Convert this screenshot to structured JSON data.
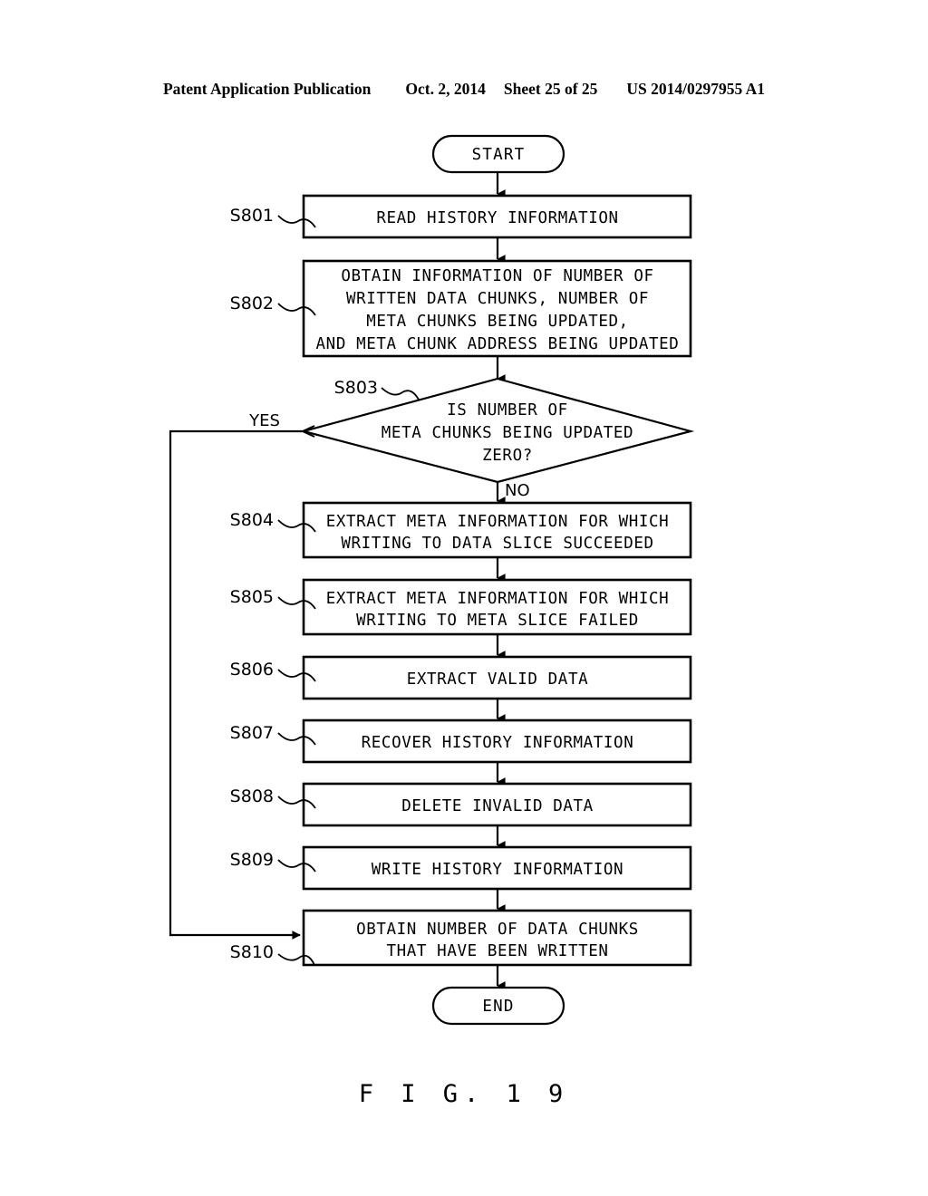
{
  "header": {
    "publication": "Patent Application Publication",
    "date": "Oct. 2, 2014",
    "sheet": "Sheet 25 of 25",
    "doc_number": "US 2014/0297955 A1"
  },
  "figure": {
    "caption": "F I G.  1 9"
  },
  "flowchart": {
    "start_label": "START",
    "end_label": "END",
    "yes_label": "YES",
    "no_label": "NO",
    "steps": [
      {
        "id": "S801",
        "lines": [
          "READ HISTORY INFORMATION"
        ]
      },
      {
        "id": "S802",
        "lines": [
          "OBTAIN INFORMATION OF NUMBER OF",
          "WRITTEN DATA CHUNKS, NUMBER OF",
          "META CHUNKS BEING UPDATED,",
          "AND META CHUNK ADDRESS BEING UPDATED"
        ]
      },
      {
        "id": "S803",
        "lines": [
          "IS NUMBER OF",
          "META CHUNKS BEING UPDATED",
          "ZERO?"
        ]
      },
      {
        "id": "S804",
        "lines": [
          "EXTRACT META INFORMATION FOR WHICH",
          "WRITING TO DATA SLICE SUCCEEDED"
        ]
      },
      {
        "id": "S805",
        "lines": [
          "EXTRACT META INFORMATION FOR WHICH",
          "WRITING TO META SLICE FAILED"
        ]
      },
      {
        "id": "S806",
        "lines": [
          "EXTRACT VALID DATA"
        ]
      },
      {
        "id": "S807",
        "lines": [
          "RECOVER HISTORY INFORMATION"
        ]
      },
      {
        "id": "S808",
        "lines": [
          "DELETE INVALID DATA"
        ]
      },
      {
        "id": "S809",
        "lines": [
          "WRITE HISTORY INFORMATION"
        ]
      },
      {
        "id": "S810",
        "lines": [
          "OBTAIN NUMBER OF DATA CHUNKS",
          "THAT HAVE BEEN WRITTEN"
        ]
      }
    ]
  },
  "colors": {
    "ink": "#000000",
    "paper": "#ffffff"
  }
}
